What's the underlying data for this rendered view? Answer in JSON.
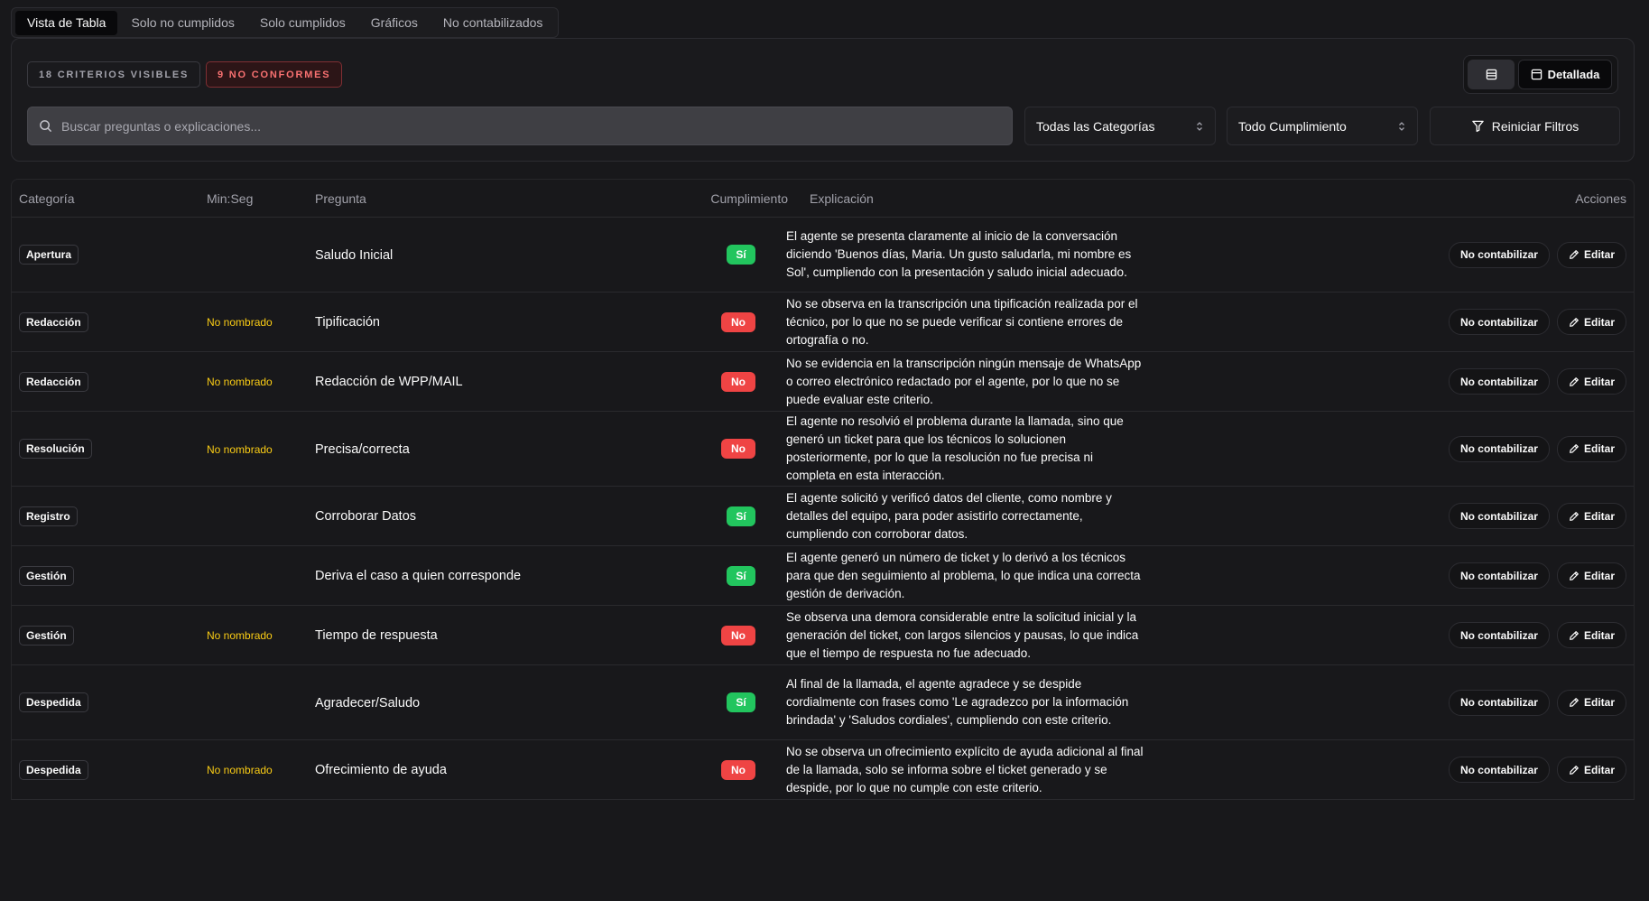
{
  "tabs": [
    {
      "label": "Vista de Tabla",
      "active": true
    },
    {
      "label": "Solo no cumplidos",
      "active": false
    },
    {
      "label": "Solo cumplidos",
      "active": false
    },
    {
      "label": "Gráficos",
      "active": false
    },
    {
      "label": "No contabilizados",
      "active": false
    }
  ],
  "summary": {
    "visible_badge": "18 CRITERIOS VISIBLES",
    "nonconf_badge": "9 NO CONFORMES"
  },
  "view_toggle": {
    "compact_icon": "rows-icon",
    "detailed_label": "Detallada"
  },
  "filters": {
    "search_placeholder": "Buscar preguntas o explicaciones...",
    "search_value": "",
    "category_selected": "Todas las Categorías",
    "compliance_selected": "Todo Cumplimiento",
    "reset_label": "Reiniciar Filtros"
  },
  "table": {
    "headers": {
      "categoria": "Categoría",
      "minseg": "Min:Seg",
      "pregunta": "Pregunta",
      "cumplimiento": "Cumplimiento",
      "explicacion": "Explicación",
      "acciones": "Acciones"
    },
    "action_labels": {
      "no_contabilizar": "No contabilizar",
      "editar": "Editar"
    },
    "rows": [
      {
        "categoria": "Apertura",
        "minseg": "",
        "pregunta": "Saludo Inicial",
        "cumplimiento": "Sí",
        "status": "si",
        "explicacion": "El agente se presenta claramente al inicio de la conversación diciendo 'Buenos días, Maria. Un gusto saludarla, mi nombre es Sol', cumpliendo con la presentación y saludo inicial adecuado."
      },
      {
        "categoria": "Redacción",
        "minseg": "No nombrado",
        "pregunta": "Tipificación",
        "cumplimiento": "No",
        "status": "no",
        "explicacion": "No se observa en la transcripción una tipificación realizada por el técnico, por lo que no se puede verificar si contiene errores de ortografía o no."
      },
      {
        "categoria": "Redacción",
        "minseg": "No nombrado",
        "pregunta": "Redacción de WPP/MAIL",
        "cumplimiento": "No",
        "status": "no",
        "explicacion": "No se evidencia en la transcripción ningún mensaje de WhatsApp o correo electrónico redactado por el agente, por lo que no se puede evaluar este criterio."
      },
      {
        "categoria": "Resolución",
        "minseg": "No nombrado",
        "pregunta": "Precisa/correcta",
        "cumplimiento": "No",
        "status": "no",
        "explicacion": "El agente no resolvió el problema durante la llamada, sino que generó un ticket para que los técnicos lo solucionen posteriormente, por lo que la resolución no fue precisa ni completa en esta interacción."
      },
      {
        "categoria": "Registro",
        "minseg": "",
        "pregunta": "Corroborar Datos",
        "cumplimiento": "Sí",
        "status": "si",
        "explicacion": "El agente solicitó y verificó datos del cliente, como nombre y detalles del equipo, para poder asistirlo correctamente, cumpliendo con corroborar datos."
      },
      {
        "categoria": "Gestión",
        "minseg": "",
        "pregunta": "Deriva el caso a quien corresponde",
        "cumplimiento": "Sí",
        "status": "si",
        "explicacion": "El agente generó un número de ticket y lo derivó a los técnicos para que den seguimiento al problema, lo que indica una correcta gestión de derivación."
      },
      {
        "categoria": "Gestión",
        "minseg": "No nombrado",
        "pregunta": "Tiempo de respuesta",
        "cumplimiento": "No",
        "status": "no",
        "explicacion": "Se observa una demora considerable entre la solicitud inicial y la generación del ticket, con largos silencios y pausas, lo que indica que el tiempo de respuesta no fue adecuado."
      },
      {
        "categoria": "Despedida",
        "minseg": "",
        "pregunta": "Agradecer/Saludo",
        "cumplimiento": "Sí",
        "status": "si",
        "explicacion": "Al final de la llamada, el agente agradece y se despide cordialmente con frases como 'Le agradezco por la información brindada' y 'Saludos cordiales', cumpliendo con este criterio."
      },
      {
        "categoria": "Despedida",
        "minseg": "No nombrado",
        "pregunta": "Ofrecimiento de ayuda",
        "cumplimiento": "No",
        "status": "no",
        "explicacion": "No se observa un ofrecimiento explícito de ayuda adicional al final de la llamada, solo se informa sobre el ticket generado y se despide, por lo que no cumple con este criterio."
      }
    ]
  },
  "colors": {
    "background": "#18181b",
    "si": "#22c55e",
    "no": "#ef4444",
    "minseg": "#facc15",
    "nonconf": "#f87171"
  }
}
